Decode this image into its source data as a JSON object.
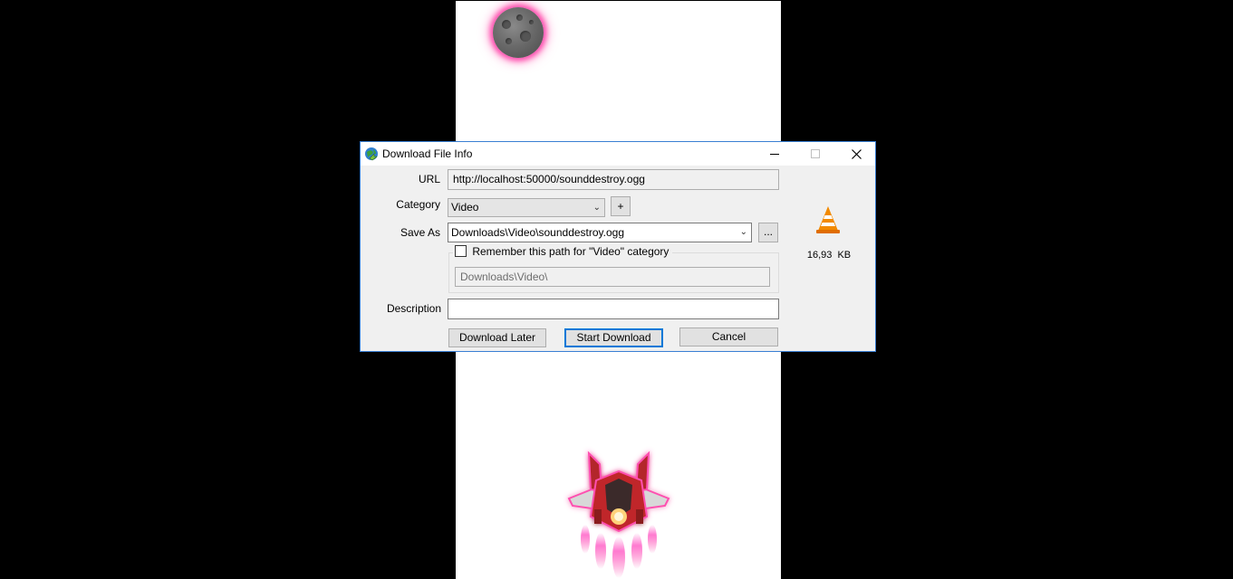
{
  "dialog": {
    "title": "Download File Info",
    "window_buttons": {
      "minimize": "—",
      "maximize": "☐",
      "close": "✕"
    },
    "url_label": "URL",
    "url_value": "http://localhost:50000/sounddestroy.ogg",
    "category_label": "Category",
    "category_value": "Video",
    "add_category_label": "+",
    "save_as_label": "Save As",
    "save_as_value": "Downloads\\Video\\sounddestroy.ogg",
    "browse_label": "...",
    "remember_label": "Remember this path for \"Video\" category",
    "remember_checked": false,
    "remember_path": "Downloads\\Video\\",
    "description_label": "Description",
    "description_value": "",
    "file_size": "16,93  KB",
    "file_icon": "vlc-cone-icon",
    "buttons": {
      "download_later": "Download Later",
      "start_download": "Start Download",
      "cancel": "Cancel"
    }
  },
  "game": {
    "asteroid_icon": "asteroid-icon",
    "ship_icon": "spaceship-icon",
    "glow_color": "#ff4fb0"
  }
}
